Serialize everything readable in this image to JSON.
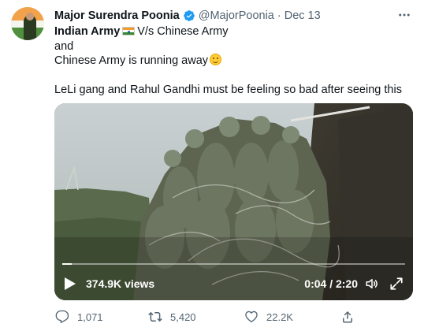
{
  "author": {
    "name": "Major Surendra Poonia",
    "handle": "@MajorPoonia",
    "separator": "·",
    "date": "Dec 13",
    "verified": true,
    "avatar_icon": "profile-photo"
  },
  "tweet": {
    "line1_bold": "Indian Army",
    "line1_rest": "V/s Chinese Army",
    "line2": "and",
    "line3": "Chinese Army is running away",
    "line5": "LeLi gang and Rahul Gandhi must be feeling so bad after seeing this",
    "emoji_1": "india-flag-emoji",
    "emoji_2": "smiling-face-emoji"
  },
  "video": {
    "views": "374.9K views",
    "time": "0:04 / 2:20",
    "progress": 0.028,
    "icons": [
      "play-icon",
      "volume-icon",
      "fullscreen-icon"
    ]
  },
  "actions": {
    "replies": "1,071",
    "retweets": "5,420",
    "likes": "22.2K"
  },
  "colors": {
    "text": "#0f1419",
    "muted": "#536471",
    "verified": "#1d9bf0"
  }
}
